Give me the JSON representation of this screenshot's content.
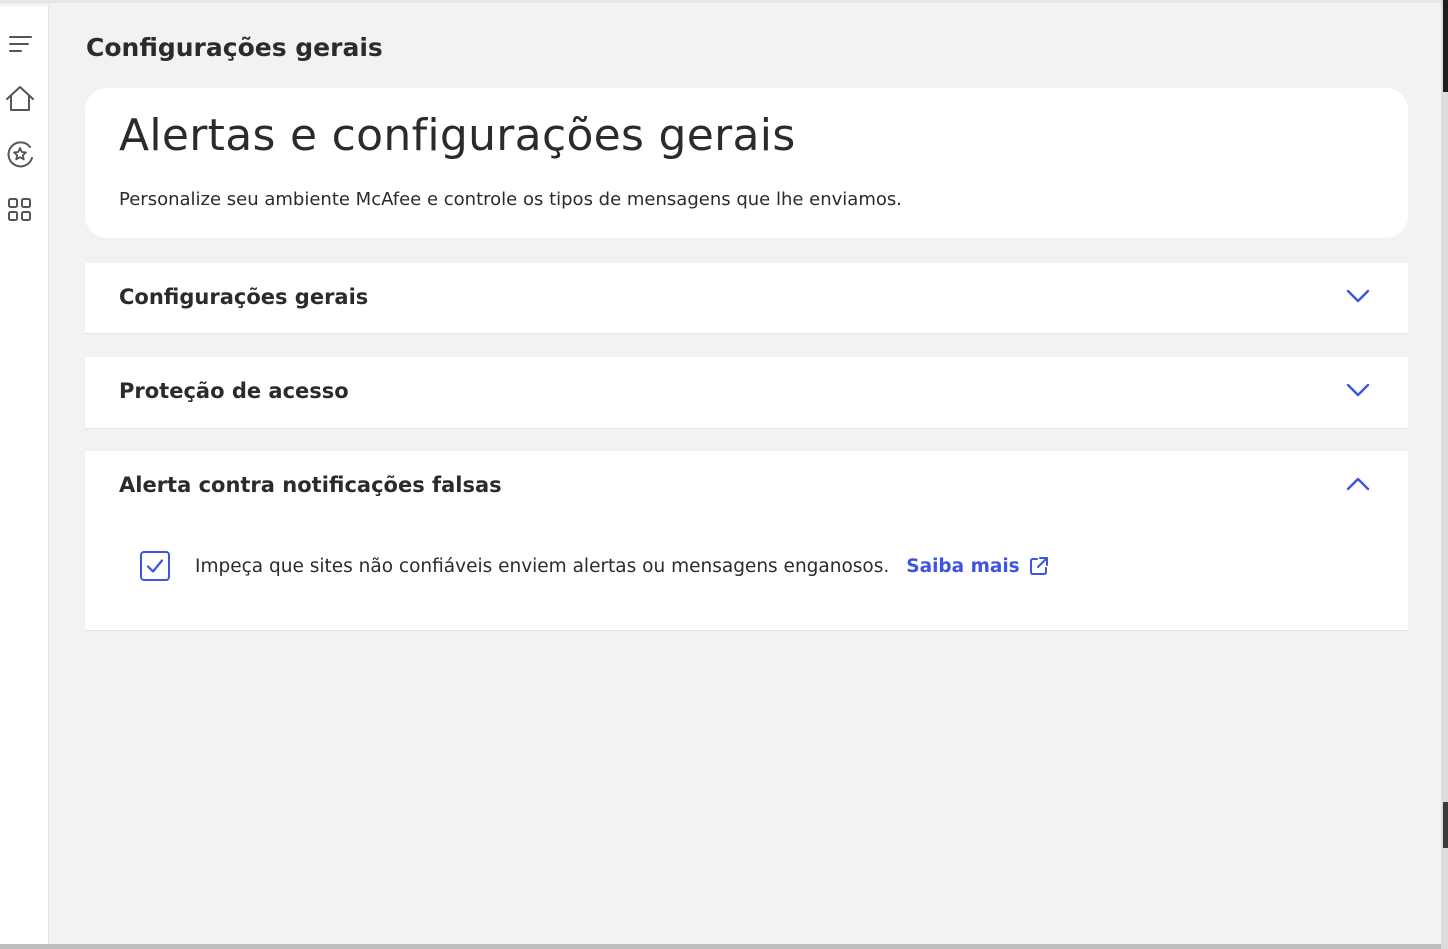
{
  "page": {
    "title": "Configurações gerais"
  },
  "sidebar": {
    "items": [
      {
        "icon": "menu-icon"
      },
      {
        "icon": "home-icon"
      },
      {
        "icon": "star-protection-icon"
      },
      {
        "icon": "apps-grid-icon"
      }
    ]
  },
  "hero": {
    "heading": "Alertas e configurações gerais",
    "description": "Personalize seu ambiente McAfee e controle os tipos de mensagens que lhe enviamos."
  },
  "sections": [
    {
      "title": "Configurações gerais",
      "expanded": false
    },
    {
      "title": "Proteção de acesso",
      "expanded": false
    },
    {
      "title": "Alerta contra notificações falsas",
      "expanded": true,
      "option": {
        "checked": true,
        "text": "Impeça que sites não confiáveis enviem alertas ou mensagens enganosos.",
        "link_label": "Saiba mais"
      }
    }
  ],
  "colors": {
    "accent": "#3d55e0",
    "background": "#f2f2f2",
    "card": "#ffffff",
    "text": "#2b2b2b"
  }
}
